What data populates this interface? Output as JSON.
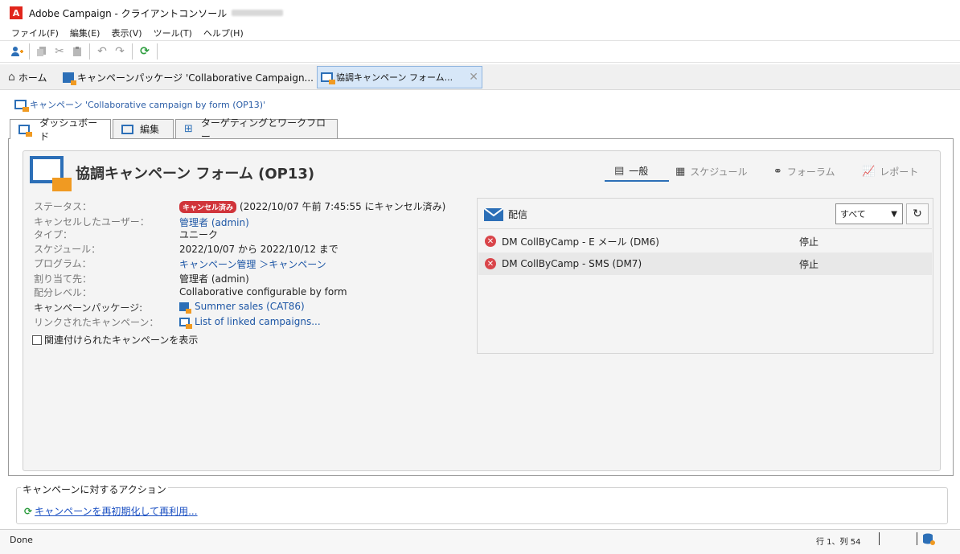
{
  "window": {
    "title": "Adobe Campaign - クライアントコンソール",
    "logo": "A"
  },
  "menu": [
    "ファイル(F)",
    "編集(E)",
    "表示(V)",
    "ツール(T)",
    "ヘルプ(H)"
  ],
  "doc_tabs": {
    "home": "ホーム",
    "package": "キャンペーンパッケージ 'Collaborative Campaign...",
    "form": "協調キャンペーン フォーム..."
  },
  "breadcrumb": "キャンペーン 'Collaborative campaign by form (OP13)'",
  "page_tabs": [
    "ダッシュボード",
    "編集",
    "ターゲティングとワークフロー"
  ],
  "header": {
    "title": "協調キャンペーン フォーム (OP13)"
  },
  "view_tabs": [
    "一般",
    "スケジュール",
    "フォーラム",
    "レポート"
  ],
  "details": {
    "status_label": "ステータス：",
    "status_badge": "キャンセル済み",
    "status_text": "(2022/10/07 午前 7:45:55 にキャンセル済み)",
    "cancel_user_label": "キャンセルしたユーザー：",
    "cancel_user": "管理者 (admin)",
    "type_label": "タイプ：",
    "type": "ユニーク",
    "schedule_label": "スケジュール：",
    "schedule": "2022/10/07 から 2022/10/12 まで",
    "program_label": "プログラム：",
    "program": "キャンペーン管理 ＞キャンペーン",
    "assignee_label": "割り当て先：",
    "assignee": "管理者 (admin)",
    "distribution_label": "配分レベル：",
    "distribution": "Collaborative configurable by form",
    "package_label": "キャンペーンパッケージ:",
    "package": "Summer sales (CAT86)",
    "linked_label": "リンクされたキャンペーン：",
    "linked": "List of linked campaigns...",
    "show_related": "関連付けられたキャンペーンを表示"
  },
  "deliveries": {
    "title": "配信",
    "filter": "すべて",
    "rows": [
      {
        "name": "DM CollByCamp - E メール (DM6)",
        "status": "停止"
      },
      {
        "name": "DM CollByCamp - SMS (DM7)",
        "status": "停止"
      }
    ]
  },
  "actions": {
    "legend": "キャンペーンに対するアクション",
    "reset_link": "キャンペーンを再初期化して再利用..."
  },
  "status_bar": {
    "left": "Done",
    "position": "行 1、列 54"
  },
  "colors": {
    "accent": "#2c6fb7",
    "orange": "#f09a22",
    "error": "#d9454a"
  }
}
